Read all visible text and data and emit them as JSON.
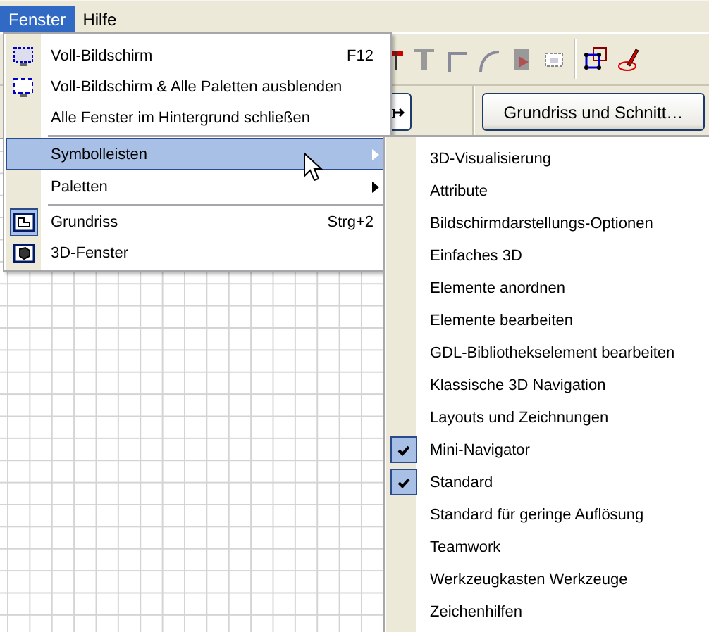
{
  "menubar": [
    {
      "label": "Fenster",
      "selected": true
    },
    {
      "label": "Hilfe",
      "selected": false
    }
  ],
  "toolbar": {
    "button": "Grundriss und Schnitt…"
  },
  "menu": {
    "items": [
      {
        "kind": "item",
        "label": "Voll-Bildschirm",
        "shortcut": "F12"
      },
      {
        "kind": "item",
        "label": "Voll-Bildschirm & Alle Paletten ausblenden"
      },
      {
        "kind": "item",
        "label": "Alle Fenster im Hintergrund schließen"
      },
      {
        "kind": "separator"
      },
      {
        "kind": "submenu",
        "label": "Symbolleisten",
        "selected": true
      },
      {
        "kind": "submenu",
        "label": "Paletten",
        "selected": false
      },
      {
        "kind": "separator"
      },
      {
        "kind": "item",
        "label": "Grundriss",
        "shortcut": "Strg+2",
        "checked": true
      },
      {
        "kind": "item",
        "label": "3D-Fenster",
        "checked": false
      }
    ]
  },
  "submenu": {
    "items": [
      {
        "label": "3D-Visualisierung",
        "checked": false
      },
      {
        "label": "Attribute",
        "checked": false
      },
      {
        "label": "Bildschirmdarstellungs-Optionen",
        "checked": false
      },
      {
        "label": "Einfaches 3D",
        "checked": false
      },
      {
        "label": "Elemente anordnen",
        "checked": false
      },
      {
        "label": "Elemente bearbeiten",
        "checked": false
      },
      {
        "label": "GDL-Bibliothekselement bearbeiten",
        "checked": false
      },
      {
        "label": "Klassische 3D Navigation",
        "checked": false
      },
      {
        "label": "Layouts und Zeichnungen",
        "checked": false
      },
      {
        "label": "Mini-Navigator",
        "checked": true
      },
      {
        "label": "Standard",
        "checked": true
      },
      {
        "label": "Standard für geringe Auflösung",
        "checked": false
      },
      {
        "label": "Teamwork",
        "checked": false
      },
      {
        "label": "Werkzeugkasten Werkzeuge",
        "checked": false
      },
      {
        "label": "Zeichenhilfen",
        "checked": false
      }
    ]
  }
}
